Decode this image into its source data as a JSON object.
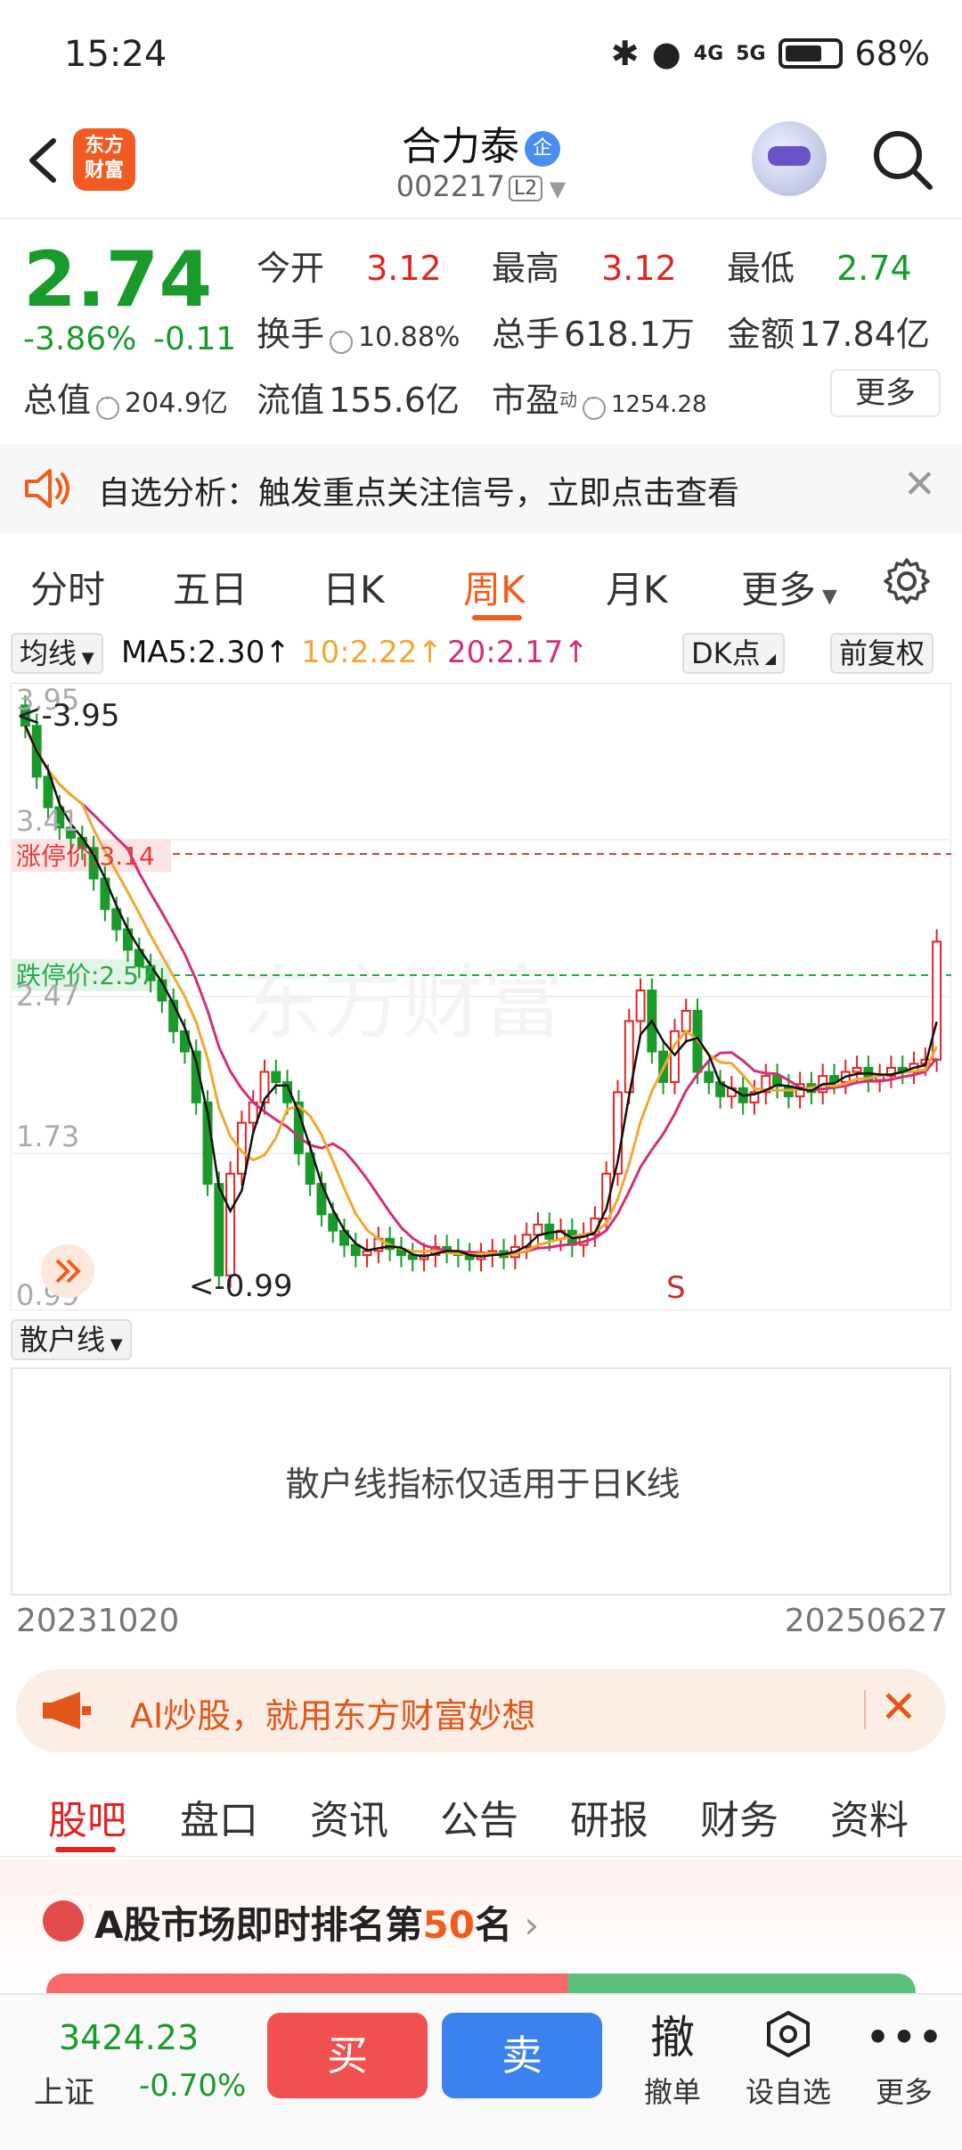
{
  "status_bar": {
    "time": "15:24",
    "battery": "68%",
    "net1": "4G",
    "net2": "5G"
  },
  "header": {
    "logo": "东方\n财富",
    "stock_name": "合力泰",
    "badge": "企",
    "stock_code": "002217",
    "level": "L2"
  },
  "quote": {
    "price": "2.74",
    "change_pct": "-3.86%",
    "change_abs": "-0.11",
    "fields": {
      "open_label": "今开",
      "open": "3.12",
      "high_label": "最高",
      "high": "3.12",
      "low_label": "最低",
      "low": "2.74",
      "turnover_label": "换手",
      "turnover": "10.88%",
      "volume_label": "总手",
      "volume": "618.1万",
      "amount_label": "金额",
      "amount": "17.84亿",
      "mktcap_label": "总值",
      "mktcap": "204.9亿",
      "float_label": "流值",
      "float": "155.6亿",
      "pe_label": "市盈",
      "pe_sup": "动",
      "pe": "1254.28"
    },
    "more_label": "更多"
  },
  "alert": {
    "text": "自选分析：触发重点关注信号，立即点击查看"
  },
  "period_tabs": [
    "分时",
    "五日",
    "日K",
    "周K",
    "月K",
    "更多"
  ],
  "active_period": "周K",
  "chart_toolbar": {
    "indicator": "均线",
    "ma5": "MA5:2.30↑",
    "ma10": "10:2.22↑",
    "ma20": "20:2.17↑",
    "dk": "DK点",
    "adjust": "前复权"
  },
  "chart_labels": {
    "y_top": "3.95",
    "max_label": "<-3.95",
    "y_mid_hi": "3.41",
    "limit_up": "涨停价:3.14",
    "limit_down": "跌停价:2.57",
    "y_mid": "2.47",
    "y_low": "1.73",
    "y_bottom": "0.99",
    "min_label": "<-0.99",
    "s_marker": "S",
    "watermark": "东方财富"
  },
  "colors": {
    "up": "#e02424",
    "down": "#1a9a2a",
    "accent": "#f25c1b",
    "ma5": "#111111",
    "ma10": "#f0a830",
    "ma20": "#d0307a"
  },
  "chart_data": {
    "type": "candlestick",
    "period": "weekly",
    "ylim": [
      0.99,
      3.95
    ],
    "x_start": "20231020",
    "x_end": "20250627",
    "series": [
      {
        "name": "MA5",
        "latest": 2.3
      },
      {
        "name": "10",
        "latest": 2.22
      },
      {
        "name": "20",
        "latest": 2.17
      }
    ],
    "close": [
      3.8,
      3.55,
      3.4,
      3.3,
      3.25,
      3.2,
      3.05,
      2.9,
      2.8,
      2.7,
      2.62,
      2.55,
      2.45,
      2.3,
      2.2,
      1.95,
      1.55,
      1.1,
      1.6,
      1.85,
      1.95,
      2.1,
      2.05,
      1.95,
      1.7,
      1.55,
      1.4,
      1.32,
      1.25,
      1.2,
      1.22,
      1.28,
      1.23,
      1.2,
      1.18,
      1.2,
      1.24,
      1.22,
      1.2,
      1.18,
      1.2,
      1.22,
      1.19,
      1.24,
      1.3,
      1.35,
      1.28,
      1.32,
      1.25,
      1.3,
      1.38,
      1.6,
      2.0,
      2.35,
      2.5,
      2.2,
      2.05,
      2.3,
      2.4,
      2.1,
      2.05,
      1.98,
      2.02,
      1.95,
      2.0,
      2.08,
      2.03,
      1.98,
      2.04,
      2.0,
      2.08,
      2.05,
      2.1,
      2.12,
      2.06,
      2.08,
      2.12,
      2.1,
      2.14,
      2.16,
      2.74
    ]
  },
  "scatter_section": {
    "title": "散户线",
    "message": "散户线指标仅适用于日K线"
  },
  "dates": {
    "start": "20231020",
    "end": "20250627"
  },
  "ai_banner": {
    "text": "AI炒股，就用东方财富妙想"
  },
  "lower_tabs": [
    "股吧",
    "盘口",
    "资讯",
    "公告",
    "研报",
    "财务",
    "资料"
  ],
  "ranking": {
    "prefix": "A股市场即时排名第",
    "rank": "50",
    "suffix": "名"
  },
  "bottom_bar": {
    "index_value": "3424.23",
    "index_name": "上证",
    "index_change": "-0.70%",
    "buy": "买",
    "sell": "卖",
    "cancel_glyph": "撤",
    "cancel": "撤单",
    "watchlist": "设自选",
    "more": "更多"
  }
}
